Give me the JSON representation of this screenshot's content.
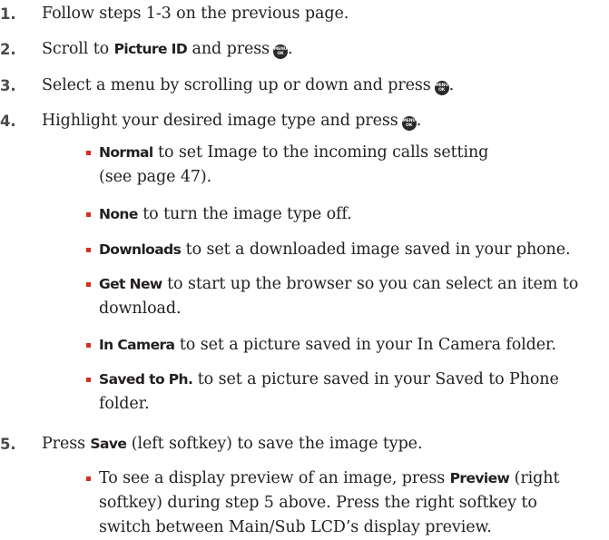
{
  "steps": [
    {
      "num": "1.",
      "text": "Follow steps 1-3 on the previous page."
    },
    {
      "num": "2.",
      "pre": "Scroll to ",
      "bold": "Picture ID",
      "post": " and press"
    },
    {
      "num": "3.",
      "pre": "Select a menu by scrolling up or down and press"
    },
    {
      "num": "4.",
      "pre": "Highlight your desired image type and press"
    },
    {
      "num": "5.",
      "pre": "Press ",
      "bold": "Save",
      "post": " (left softkey) to save the image type."
    }
  ],
  "menu_ok_button": {
    "top": "MENU",
    "bottom": "OK"
  },
  "options": [
    {
      "bold": "Normal",
      "line1": " to set Image to the incoming calls setting",
      "line2": "(see page 47)."
    },
    {
      "bold": "None",
      "line1": " to turn the image type off."
    },
    {
      "bold": "Downloads",
      "line1": " to set a downloaded image saved in your phone."
    },
    {
      "bold": "Get New",
      "line1": " to start up the browser so you can select an item to",
      "line2": "download."
    },
    {
      "bold": "In Camera",
      "line1": " to set a picture saved in your In Camera folder."
    },
    {
      "bold": "Saved to Ph.",
      "line1": " to set a picture saved in your Saved to Phone",
      "line2": "folder."
    }
  ],
  "note": {
    "pre": "To see a display preview of an image, press ",
    "bold": "Preview",
    "line1_post": " (right",
    "line2": "softkey) during step 5 above. Press the right softkey to",
    "line3": "switch between Main/Sub LCD’s display preview."
  }
}
